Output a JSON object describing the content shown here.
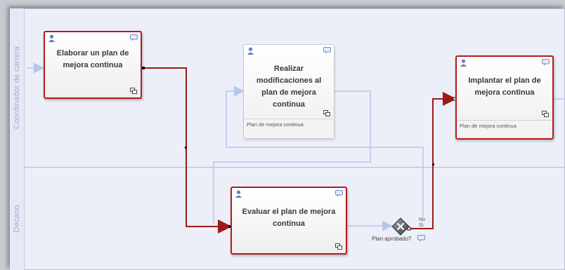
{
  "lanes": [
    {
      "title": "Coordinador de carrera"
    },
    {
      "title": "Decano"
    }
  ],
  "tasks": {
    "elaborar": {
      "name": "Elaborar un plan de mejora continua"
    },
    "realizar": {
      "name": "Realizar modificaciones al plan de mejora continua",
      "artifact": "Plan de mejora continua"
    },
    "implantar": {
      "name": "Implantar el plan de mejora continua",
      "artifact": "Plan de mejora continua"
    },
    "evaluar": {
      "name": "Evaluar el plan de mejora continua"
    }
  },
  "gateway": {
    "label": "Plan aprobado?",
    "option_no": "No",
    "option_si": "Si"
  },
  "colors": {
    "active_border": "#b31c1c",
    "flow_active": "#9b1b1b",
    "flow_idle": "#b7c6ec",
    "lane_bg": "#eceef8"
  },
  "icons": [
    "user-icon",
    "comment-icon",
    "subprocess-icon",
    "gateway-icon"
  ]
}
